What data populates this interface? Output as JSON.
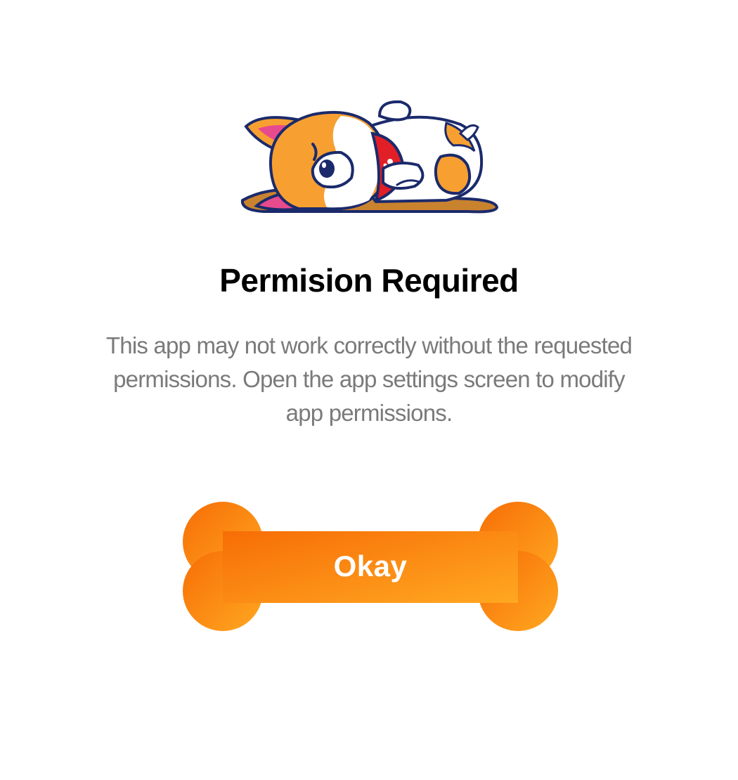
{
  "dialog": {
    "illustration_icon": "sleeping-corgi-icon",
    "title": "Permision Required",
    "message": "This app may not work correctly without the requested permissions. Open the app settings screen to modify app permissions.",
    "button": {
      "label": "Okay",
      "shape": "bone",
      "gradient_start": "#F76D06",
      "gradient_end": "#FFA821"
    }
  },
  "colors": {
    "background": "#FFFFFF",
    "title": "#000000",
    "message": "#7A7A7A",
    "outline": "#1B2A6B",
    "corgi_orange": "#F7A031",
    "bandana_red": "#E21F26"
  }
}
